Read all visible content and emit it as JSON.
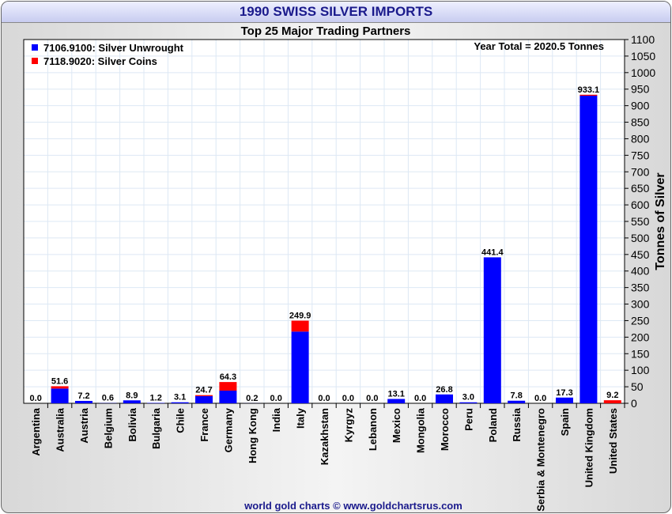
{
  "header": {
    "title": "1990 SWISS SILVER IMPORTS",
    "footer": "world gold charts © www.goldchartsrus.com"
  },
  "chart_data": {
    "type": "bar",
    "stacked": true,
    "title": "Top 25 Major Trading Partners",
    "annotation": "Year Total = 2020.5 Tonnes",
    "ylabel": "Tonnes of Silver",
    "xlabel": "",
    "ylim": [
      0,
      1100
    ],
    "ytick_step": 50,
    "grid": true,
    "legend_position": "top-left",
    "categories": [
      "Argentina",
      "Australia",
      "Austria",
      "Belgium",
      "Bolivia",
      "Bulgaria",
      "Chile",
      "France",
      "Germany",
      "Hong Kong",
      "India",
      "Italy",
      "Kazakhstan",
      "Kyrgyz",
      "Lebanon",
      "Mexico",
      "Mongolia",
      "Morocco",
      "Peru",
      "Poland",
      "Russia",
      "Serbia & Montenegro",
      "Spain",
      "United Kingdom",
      "United States"
    ],
    "totals": [
      "0.0",
      "51.6",
      "7.2",
      "0.6",
      "8.9",
      "1.2",
      "3.1",
      "24.7",
      "64.3",
      "0.2",
      "0.0",
      "249.9",
      "0.0",
      "0.0",
      "0.0",
      "13.1",
      "0.0",
      "26.8",
      "3.0",
      "441.4",
      "7.8",
      "0.0",
      "17.3",
      "933.1",
      "9.2"
    ],
    "series": [
      {
        "name": "7106.9100: Silver Unwrought",
        "color": "#0000ff",
        "values": [
          0,
          44.6,
          7.2,
          0.6,
          8.9,
          1.2,
          3.1,
          21.7,
          38.3,
          0.2,
          0,
          216.9,
          0,
          0,
          0,
          13.1,
          0,
          26.8,
          3.0,
          441.4,
          7.8,
          0,
          17.3,
          930.1,
          0
        ]
      },
      {
        "name": "7118.9020: Silver Coins",
        "color": "#ff0000",
        "values": [
          0,
          7.0,
          0,
          0,
          0,
          0,
          0,
          3.0,
          26.0,
          0,
          0,
          33.0,
          0,
          0,
          0,
          0,
          0,
          0,
          0,
          0,
          0,
          0,
          0,
          3.0,
          9.2
        ]
      }
    ]
  }
}
